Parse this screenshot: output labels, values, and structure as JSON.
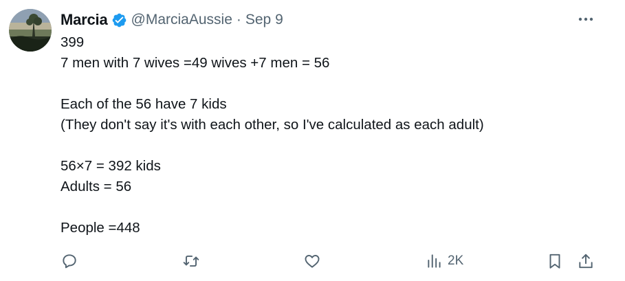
{
  "tweet": {
    "display_name": "Marcia",
    "handle": "@MarciaAussie",
    "separator": "·",
    "date": "Sep 9",
    "lines": [
      "399",
      "7 men with 7 wives =49 wives +7 men = 56",
      "",
      "Each of the 56 have 7 kids",
      "(They don't say it's with each other, so I've calculated as each adult)",
      "",
      "56×7 = 392 kids",
      "Adults = 56",
      "",
      "People =448"
    ]
  },
  "actions": {
    "views_count": "2K"
  },
  "icons": {
    "verified": "verified-badge-icon",
    "more": "more-icon",
    "reply": "reply-icon",
    "retweet": "retweet-icon",
    "like": "like-icon",
    "views": "views-icon",
    "bookmark": "bookmark-icon",
    "share": "share-icon"
  },
  "colors": {
    "text": "#0f1419",
    "secondary": "#536471",
    "verified": "#1d9bf0"
  }
}
